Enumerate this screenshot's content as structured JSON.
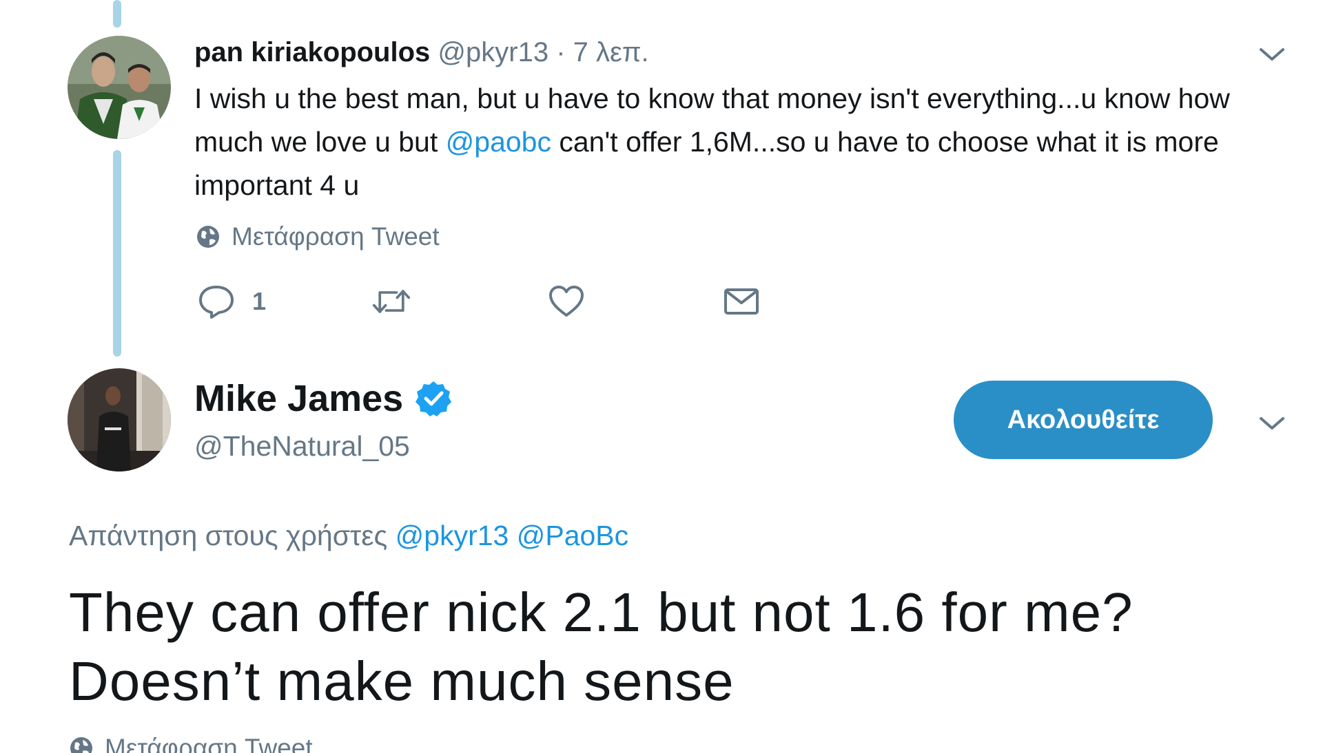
{
  "reply_tweet": {
    "author_name": "pan kiriakopoulos",
    "author_handle": "@pkyr13",
    "separator": "·",
    "time": "7 λεπ.",
    "text_before_mention": "I wish u the best man, but u have to know that money isn't everything...u know how much we love u but ",
    "mention": "@paobc",
    "text_after_mention": " can't offer 1,6M...so u have to choose what it is more important 4 u",
    "translate_label": "Μετάφραση Tweet",
    "reply_count": "1",
    "icons": {
      "reply": "reply-icon",
      "retweet": "retweet-icon",
      "like": "heart-icon",
      "message": "envelope-icon",
      "translate": "globe-icon",
      "menu": "chevron-down-icon"
    }
  },
  "main_tweet": {
    "author_name": "Mike James",
    "author_handle": "@TheNatural_05",
    "follow_label": "Ακολουθείτε",
    "reply_prefix": "Απάντηση στους χρήστες",
    "reply_mention_1": "@pkyr13",
    "reply_mention_2": "@PaoBc",
    "text": "They can offer nick 2.1 but not 1.6 for me? Doesn’t make much sense",
    "translate_label": "Μετάφραση Tweet",
    "icons": {
      "verified": "verified-badge-icon",
      "menu": "chevron-down-icon",
      "translate": "globe-icon"
    }
  },
  "colors": {
    "accent": "#1b95e0",
    "follow_button": "#2b8fc7",
    "thread_line": "#a8d4e6",
    "muted_text": "#657786",
    "primary_text": "#14171a"
  }
}
